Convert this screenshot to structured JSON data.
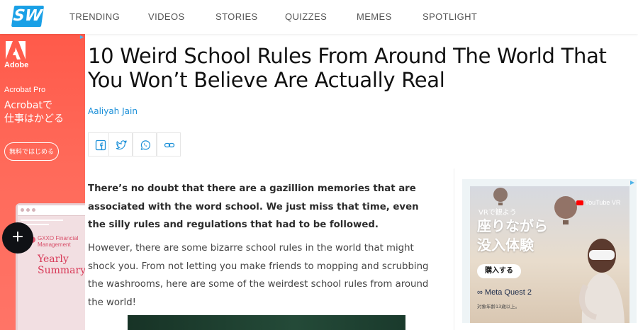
{
  "site": {
    "logo_text": "SW",
    "brand_color": "#1aa0e6"
  },
  "nav": {
    "items": [
      "TRENDING",
      "VIDEOS",
      "STORIES",
      "QUIZZES",
      "MEMES",
      "SPOTLIGHT"
    ]
  },
  "left_ad": {
    "brand": "Adobe",
    "product": "Acrobat Pro",
    "headline": "Acrobatで\n仕事はかどる",
    "cta": "無料ではじめる",
    "screen_company": "GXXO Financial Management",
    "screen_title": "Yearly Summary",
    "background_color": "#ff5a4a"
  },
  "fab": {
    "label": "+",
    "icon": "plus-icon"
  },
  "article": {
    "title": "10 Weird School Rules From Around The World That You Won’t Believe Are Actually Real",
    "author": "Aaliyah Jain",
    "share_buttons": [
      "facebook-icon",
      "twitter-icon",
      "whatsapp-icon",
      "link-icon"
    ],
    "paragraphs": [
      "There’s no doubt that there are a gazillion memories that are associated with the word school. We just miss that time, even the silly rules and regulations that had to be followed.",
      "However, there are some bizarre school rules in the world that might shock you. From not letting you make friends to mopping and scrubbing the washrooms, here are some of the weirdest school rules from around the world!"
    ],
    "link_color": "#1a8fd8"
  },
  "right_ad": {
    "tagline": "VRで観よう",
    "headline": "座りながら\n没入体験",
    "youtube": "YouTube VR",
    "cta": "購入する",
    "brand": "Meta Quest 2",
    "sublabel": "対象年齢13歳以上。"
  }
}
